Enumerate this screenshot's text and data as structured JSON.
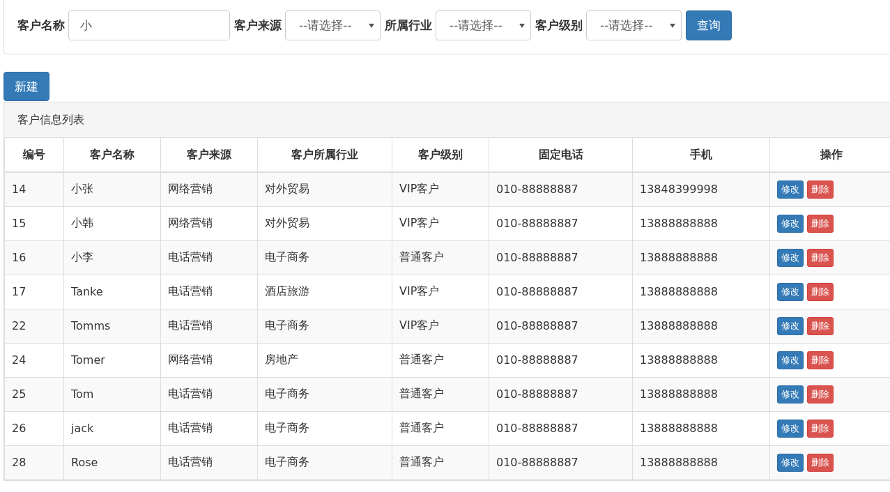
{
  "filters": [
    {
      "kind": "text",
      "label": "客户名称",
      "value": "小"
    },
    {
      "kind": "select",
      "label": "客户来源",
      "value": "--请选择--"
    },
    {
      "kind": "select",
      "label": "所属行业",
      "value": "--请选择--"
    },
    {
      "kind": "select",
      "label": "客户级别",
      "value": "--请选择--"
    }
  ],
  "query_button": "查询",
  "new_button": "新建",
  "panel_title": "客户信息列表",
  "table": {
    "columns": [
      "编号",
      "客户名称",
      "客户来源",
      "客户所属行业",
      "客户级别",
      "固定电话",
      "手机",
      "操作"
    ],
    "rows": [
      {
        "cells": [
          "14",
          "小张",
          "网络营销",
          "对外贸易",
          "VIP客户",
          "010-88888887",
          "13848399998"
        ],
        "actions": [
          "修改",
          "删除"
        ]
      },
      {
        "cells": [
          "15",
          "小韩",
          "网络营销",
          "对外贸易",
          "VIP客户",
          "010-88888887",
          "13888888888"
        ],
        "actions": [
          "修改",
          "删除"
        ]
      },
      {
        "cells": [
          "16",
          "小李",
          "电话营销",
          "电子商务",
          "普通客户",
          "010-88888887",
          "13888888888"
        ],
        "actions": [
          "修改",
          "删除"
        ]
      },
      {
        "cells": [
          "17",
          "Tanke",
          "电话营销",
          "酒店旅游",
          "VIP客户",
          "010-88888887",
          "13888888888"
        ],
        "actions": [
          "修改",
          "删除"
        ]
      },
      {
        "cells": [
          "22",
          "Tomms",
          "电话营销",
          "电子商务",
          "VIP客户",
          "010-88888887",
          "13888888888"
        ],
        "actions": [
          "修改",
          "删除"
        ]
      },
      {
        "cells": [
          "24",
          "Tomer",
          "网络营销",
          "房地产",
          "普通客户",
          "010-88888887",
          "13888888888"
        ],
        "actions": [
          "修改",
          "删除"
        ]
      },
      {
        "cells": [
          "25",
          "Tom",
          "电话营销",
          "电子商务",
          "普通客户",
          "010-88888887",
          "13888888888"
        ],
        "actions": [
          "修改",
          "删除"
        ]
      },
      {
        "cells": [
          "26",
          "jack",
          "电话营销",
          "电子商务",
          "普通客户",
          "010-88888887",
          "13888888888"
        ],
        "actions": [
          "修改",
          "删除"
        ]
      },
      {
        "cells": [
          "28",
          "Rose",
          "电话营销",
          "电子商务",
          "普通客户",
          "010-88888887",
          "13888888888"
        ],
        "actions": [
          "修改",
          "删除"
        ]
      }
    ]
  }
}
